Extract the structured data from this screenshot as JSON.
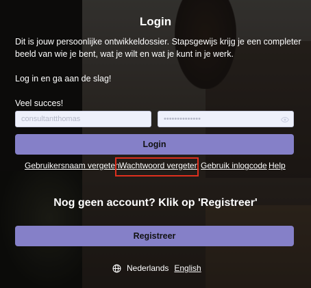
{
  "page": {
    "title": "Login",
    "intro_lines": [
      "Dit is jouw persoonlijke ontwikkeldossier. Stapsgewijs krijg je een completer beeld van wie je bent, wat je wilt en wat je kunt in je werk.",
      "Log in en ga aan de slag!",
      "Veel succes!"
    ]
  },
  "form": {
    "username_value": "consultantthomas",
    "password_value": "••••••••••••••",
    "login_label": "Login"
  },
  "links": {
    "forgot_username": "Gebruikersnaam vergeten",
    "forgot_password": "Wachtwoord vergeten",
    "use_login_code": "Gebruik inlogcode",
    "help": "Help"
  },
  "register": {
    "prompt": "Nog geen account? Klik op 'Registreer'",
    "button_label": "Registreer"
  },
  "language": {
    "icon": "globe-icon",
    "current": "Nederlands",
    "alternative": "English"
  },
  "colors": {
    "primary_button": "#8580c8",
    "highlight": "#e0301e"
  }
}
